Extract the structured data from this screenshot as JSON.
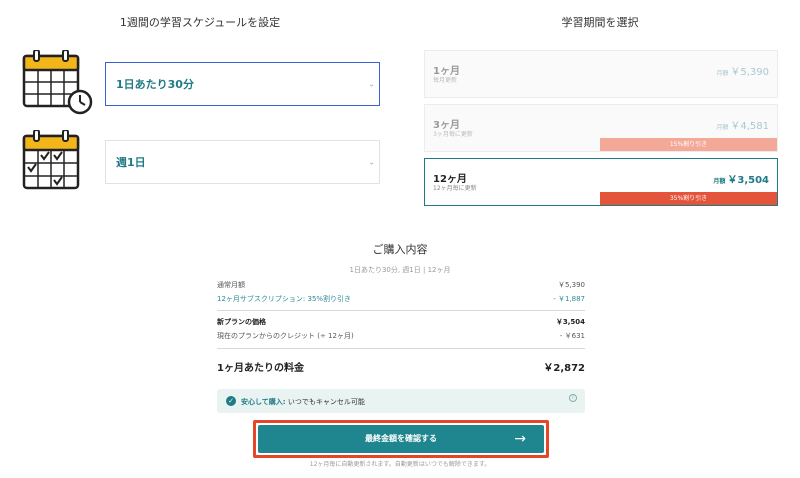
{
  "schedule": {
    "title": "1週間の学習スケジュールを設定",
    "duration_value": "1日あたり30分",
    "frequency_value": "週1日"
  },
  "period": {
    "title": "学習期間を選択",
    "plans": [
      {
        "name": "1ヶ月",
        "sub": "毎月更新",
        "price_label": "月額",
        "price": "￥5,390",
        "discount": ""
      },
      {
        "name": "3ヶ月",
        "sub": "3ヶ月毎に更新",
        "price_label": "月額",
        "price": "￥4,581",
        "discount": "15%割り引き"
      },
      {
        "name": "12ヶ月",
        "sub": "12ヶ月毎に更新",
        "price_label": "月額",
        "price": "￥3,504",
        "discount": "35%割り引き"
      }
    ],
    "selected": "12ヶ月"
  },
  "summary": {
    "title": "ご購入内容",
    "subtitle": "1日あたり30分, 週1日 | 12ヶ月",
    "rows": [
      {
        "label": "通常月額",
        "value": "￥5,390"
      },
      {
        "label": "12ヶ月サブスクリプション: 35%割り引き",
        "value": "- ￥1,887"
      },
      {
        "label": "新プランの価格",
        "value": "￥3,504"
      },
      {
        "label": "現在のプランからのクレジット (÷ 12ヶ月)",
        "value": "- ￥631"
      }
    ],
    "total_label": "1ヶ月あたりの料金",
    "total_value": "￥2,872",
    "safe_strong": "安心して購入:",
    "safe_text": " いつでもキャンセル可能",
    "cta_label": "最終金額を確認する",
    "footnote": "12ヶ月毎に自動更新されます。自動更新はいつでも解除できます。"
  },
  "colors": {
    "accent": "#1f868f",
    "discount_light": "#f4a898",
    "discount_strong": "#e3543a",
    "highlight_outline": "#e64527"
  },
  "icons": {
    "calendar_clock": "calendar-clock-icon",
    "calendar_check": "calendar-check-icon",
    "arrow_right": "arrow-right-icon",
    "check": "check-circle-icon",
    "info": "info-icon"
  }
}
